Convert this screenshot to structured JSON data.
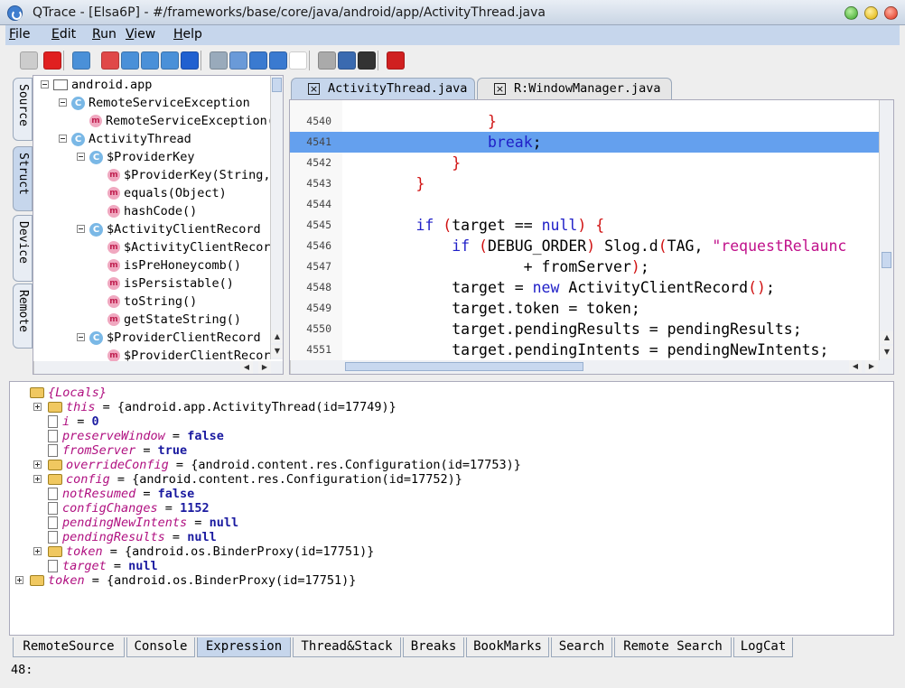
{
  "window": {
    "title": "QTrace - [Elsa6P] - #/frameworks/base/core/java/android/app/ActivityThread.java"
  },
  "menu": [
    "File",
    "Edit",
    "Run",
    "View",
    "Help"
  ],
  "toolbar": {
    "icons": [
      "debug-icon",
      "stop-icon",
      "database-icon",
      "breakpoint-icon",
      "step-over-icon",
      "step-into-icon",
      "step-out-icon",
      "resume-icon",
      "zoom-icon",
      "zoom-fit-icon",
      "back-icon",
      "forward-icon",
      "blank-icon",
      "window-icon",
      "layout-icon",
      "terminal-icon",
      "power-icon"
    ]
  },
  "side_tabs": [
    "Source",
    "Struct",
    "Device",
    "Remote"
  ],
  "struct_tree": [
    {
      "indent": 0,
      "kind": "folder",
      "label": "android.app"
    },
    {
      "indent": 1,
      "kind": "class",
      "label": "RemoteServiceException"
    },
    {
      "indent": 2,
      "kind": "method",
      "label": "RemoteServiceException("
    },
    {
      "indent": 1,
      "kind": "class",
      "label": "ActivityThread"
    },
    {
      "indent": 2,
      "kind": "class",
      "label": "$ProviderKey"
    },
    {
      "indent": 3,
      "kind": "method",
      "label": "$ProviderKey(String,"
    },
    {
      "indent": 3,
      "kind": "method",
      "label": "equals(Object)"
    },
    {
      "indent": 3,
      "kind": "method",
      "label": "hashCode()"
    },
    {
      "indent": 2,
      "kind": "class",
      "label": "$ActivityClientRecord"
    },
    {
      "indent": 3,
      "kind": "method",
      "label": "$ActivityClientRecor"
    },
    {
      "indent": 3,
      "kind": "method",
      "label": "isPreHoneycomb()"
    },
    {
      "indent": 3,
      "kind": "method",
      "label": "isPersistable()"
    },
    {
      "indent": 3,
      "kind": "method",
      "label": "toString()"
    },
    {
      "indent": 3,
      "kind": "method",
      "label": "getStateString()"
    },
    {
      "indent": 2,
      "kind": "class",
      "label": "$ProviderClientRecord"
    },
    {
      "indent": 3,
      "kind": "method",
      "label": "$ProviderClientRecor"
    }
  ],
  "editor_tabs": [
    "ActivityThread.java",
    "R:WindowManager.java"
  ],
  "code_lines": [
    {
      "num": "4540",
      "code": [
        {
          "t": "                }",
          "c": "sym"
        }
      ]
    },
    {
      "num": "4541",
      "code": [
        {
          "t": "                ",
          "c": ""
        },
        {
          "t": "break",
          "c": "kw"
        },
        {
          "t": ";",
          "c": ""
        }
      ],
      "highlight": true
    },
    {
      "num": "4542",
      "code": [
        {
          "t": "            }",
          "c": "sym"
        }
      ]
    },
    {
      "num": "4543",
      "code": [
        {
          "t": "        }",
          "c": "sym"
        }
      ]
    },
    {
      "num": "4544",
      "code": [
        {
          "t": "",
          "c": ""
        }
      ]
    },
    {
      "num": "4545",
      "code": [
        {
          "t": "        ",
          "c": ""
        },
        {
          "t": "if",
          "c": "kw"
        },
        {
          "t": " ",
          "c": ""
        },
        {
          "t": "(",
          "c": "sym"
        },
        {
          "t": "target == ",
          "c": ""
        },
        {
          "t": "null",
          "c": "kw"
        },
        {
          "t": ")",
          "c": "sym"
        },
        {
          "t": " ",
          "c": ""
        },
        {
          "t": "{",
          "c": "sym"
        }
      ]
    },
    {
      "num": "4546",
      "code": [
        {
          "t": "            ",
          "c": ""
        },
        {
          "t": "if",
          "c": "kw"
        },
        {
          "t": " ",
          "c": ""
        },
        {
          "t": "(",
          "c": "sym"
        },
        {
          "t": "DEBUG_ORDER",
          "c": ""
        },
        {
          "t": ")",
          "c": "sym"
        },
        {
          "t": " Slog.d",
          "c": ""
        },
        {
          "t": "(",
          "c": "sym"
        },
        {
          "t": "TAG, ",
          "c": ""
        },
        {
          "t": "\"requestRelaunc",
          "c": "str"
        }
      ]
    },
    {
      "num": "4547",
      "code": [
        {
          "t": "                    + fromServer",
          "c": ""
        },
        {
          "t": ")",
          "c": "sym"
        },
        {
          "t": ";",
          "c": ""
        }
      ]
    },
    {
      "num": "4548",
      "code": [
        {
          "t": "            target = ",
          "c": ""
        },
        {
          "t": "new",
          "c": "kw"
        },
        {
          "t": " ActivityClientRecord",
          "c": ""
        },
        {
          "t": "()",
          "c": "sym"
        },
        {
          "t": ";",
          "c": ""
        }
      ]
    },
    {
      "num": "4549",
      "code": [
        {
          "t": "            target.token = token;",
          "c": ""
        }
      ]
    },
    {
      "num": "4550",
      "code": [
        {
          "t": "            target.pendingResults = pendingResults;",
          "c": ""
        }
      ]
    },
    {
      "num": "4551",
      "code": [
        {
          "t": "            target.pendingIntents = pendingNewIntents;",
          "c": ""
        }
      ]
    }
  ],
  "variables": [
    {
      "depth": 0,
      "icon": "folder",
      "expandable": false,
      "name": "{Locals}",
      "eq": "",
      "value": "",
      "vclass": ""
    },
    {
      "depth": 1,
      "icon": "folder",
      "expandable": true,
      "name": "this",
      "eq": " = ",
      "value": "{android.app.ActivityThread(id=17749)}",
      "vclass": "vobj"
    },
    {
      "depth": 1,
      "icon": "doc",
      "expandable": false,
      "name": "i",
      "eq": " = ",
      "value": "0",
      "vclass": "vval"
    },
    {
      "depth": 1,
      "icon": "doc",
      "expandable": false,
      "name": "preserveWindow",
      "eq": " = ",
      "value": "false",
      "vclass": "vval"
    },
    {
      "depth": 1,
      "icon": "doc",
      "expandable": false,
      "name": "fromServer",
      "eq": " = ",
      "value": "true",
      "vclass": "vval"
    },
    {
      "depth": 1,
      "icon": "folder",
      "expandable": true,
      "name": "overrideConfig",
      "eq": " = ",
      "value": "{android.content.res.Configuration(id=17753)}",
      "vclass": "vobj"
    },
    {
      "depth": 1,
      "icon": "folder",
      "expandable": true,
      "name": "config",
      "eq": " = ",
      "value": "{android.content.res.Configuration(id=17752)}",
      "vclass": "vobj"
    },
    {
      "depth": 1,
      "icon": "doc",
      "expandable": false,
      "name": "notResumed",
      "eq": " = ",
      "value": "false",
      "vclass": "vval"
    },
    {
      "depth": 1,
      "icon": "doc",
      "expandable": false,
      "name": "configChanges",
      "eq": " = ",
      "value": "1152",
      "vclass": "vval"
    },
    {
      "depth": 1,
      "icon": "doc",
      "expandable": false,
      "name": "pendingNewIntents",
      "eq": " = ",
      "value": "null",
      "vclass": "vval"
    },
    {
      "depth": 1,
      "icon": "doc",
      "expandable": false,
      "name": "pendingResults",
      "eq": " = ",
      "value": "null",
      "vclass": "vval"
    },
    {
      "depth": 1,
      "icon": "folder",
      "expandable": true,
      "name": "token",
      "eq": " = ",
      "value": "{android.os.BinderProxy(id=17751)}",
      "vclass": "vobj"
    },
    {
      "depth": 1,
      "icon": "doc",
      "expandable": false,
      "name": "target",
      "eq": " = ",
      "value": "null",
      "vclass": "vval"
    },
    {
      "depth": 0,
      "icon": "folder",
      "expandable": true,
      "name": "token",
      "eq": " = ",
      "value": "{android.os.BinderProxy(id=17751)}",
      "vclass": "vobj"
    }
  ],
  "bottom_tabs": [
    "RemoteSource",
    "Console",
    "Expression",
    "Thread&Stack",
    "Breaks",
    "BookMarks",
    "Search",
    "Remote Search",
    "LogCat"
  ],
  "bottom_active": "Expression",
  "status": "48:",
  "colors": {
    "highlight": "#64a0ee",
    "keyword": "#2020c8",
    "symbol": "#d01010",
    "string": "#c0108a",
    "var_name": "#b01080"
  }
}
